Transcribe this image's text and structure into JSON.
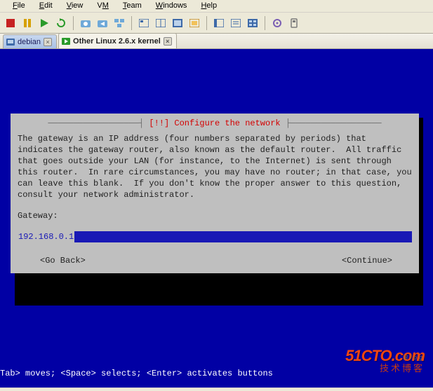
{
  "menu": {
    "file": "File",
    "edit": "Edit",
    "view": "View",
    "vm": "VM",
    "team": "Team",
    "windows": "Windows",
    "help": "Help"
  },
  "toolbar_icons": {
    "stop": "stop-icon",
    "pause": "pause-icon",
    "play": "play-icon",
    "reset": "reset-icon",
    "snapshot": "snapshot-icon",
    "snapshot_mgr": "snapshot-manager-icon",
    "revert": "revert-icon",
    "show_console": "show-console-icon",
    "quick_switch": "quick-switch-icon",
    "fullscreen": "fullscreen-icon",
    "unity": "unity-icon",
    "sidebar": "sidebar-icon",
    "summary": "summary-icon",
    "appview": "appview-icon",
    "grab1": "inventory-icon",
    "grab2": "removable-devices-icon"
  },
  "tabs": [
    {
      "label": "debian",
      "active": false
    },
    {
      "label": "Other Linux 2.6.x kernel",
      "active": true
    }
  ],
  "dialog": {
    "header_line_left": "────────────────────────┤ ",
    "header_title": "[!!] Configure the network",
    "header_line_right": " ├────────────────────────",
    "body": "The gateway is an IP address (four numbers separated by periods) that indicates the gateway router, also known as the default router.  All traffic that goes outside your LAN (for instance, to the Internet) is sent through this router.  In rare circumstances, you may have no router; in that case, you can leave this blank.  If you don't know the proper answer to this question, consult your network administrator.",
    "prompt": "Gateway:",
    "input_value": "192.168.0.1",
    "go_back": "<Go Back>",
    "continue": "<Continue>"
  },
  "footer_hint": "Tab> moves; <Space> selects; <Enter> activates buttons",
  "watermark": {
    "line1": "51CTO.com",
    "line2": "技术博客",
    "blog": "Blog"
  }
}
